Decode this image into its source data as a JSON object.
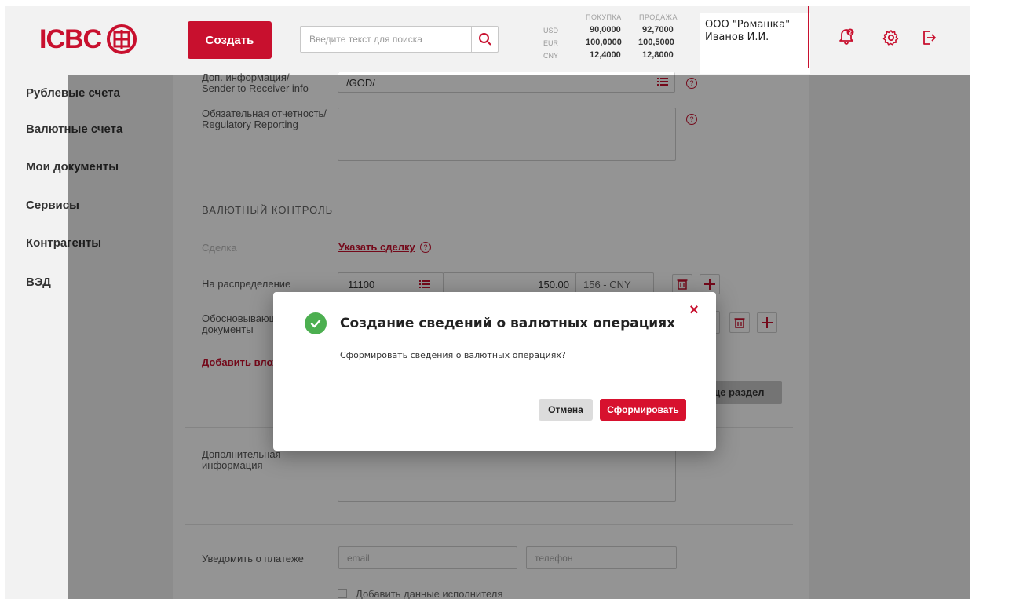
{
  "header": {
    "logo_text": "ICBC",
    "create_label": "Создать",
    "search_placeholder": "Введите текст для поиска",
    "rates": {
      "buy_label": "ПОКУПКА",
      "sell_label": "ПРОДАЖА",
      "items": [
        {
          "currency": "USD",
          "buy": "90,0000",
          "sell": "92,7000"
        },
        {
          "currency": "EUR",
          "buy": "100,0000",
          "sell": "100,5000"
        },
        {
          "currency": "CNY",
          "buy": "12,4000",
          "sell": "12,8000"
        }
      ]
    },
    "company": "ООО \"Ромашка\"",
    "user": "Иванов И.И.",
    "notification_count": "2"
  },
  "sidebar": {
    "items": [
      {
        "label": "Рублевые счета"
      },
      {
        "label": "Валютные счета"
      },
      {
        "label": "Мои документы"
      },
      {
        "label": "Сервисы"
      },
      {
        "label": "Контрагенты"
      },
      {
        "label": "ВЭД"
      }
    ]
  },
  "form": {
    "sender_info_label_1": "Доп. информация/",
    "sender_info_label_2": "Sender to Receiver info",
    "sender_info_value": "/GOD/",
    "regulatory_label_1": "Обязательная отчетность/",
    "regulatory_label_2": "Regulatory Reporting",
    "currency_control_title": "ВАЛЮТНЫЙ КОНТРОЛЬ",
    "deal_label": "Сделка",
    "deal_link": "Указать сделку",
    "distribution_label": "На распределение",
    "distribution_code": "11100",
    "distribution_amount": "150.00",
    "distribution_currency": "156 - CNY",
    "supporting_docs_label_1": "Обосновывающие",
    "supporting_docs_label_2": "документы",
    "add_attachment_link": "Добавить вложение",
    "add_section_label": "Добавить еще раздел",
    "additional_info_label_1": "Дополнительная",
    "additional_info_label_2": "информация",
    "notify_label": "Уведомить о платеже",
    "email_placeholder": "email",
    "phone_placeholder": "телефон",
    "add_executor_label": "Добавить данные исполнителя"
  },
  "modal": {
    "title": "Создание сведений о валютных операциях",
    "text": "Сформировать сведения о валютных операциях?",
    "cancel_label": "Отмена",
    "submit_label": "Сформировать"
  },
  "colors": {
    "brand": "#c8102e",
    "success": "#4caf50"
  }
}
